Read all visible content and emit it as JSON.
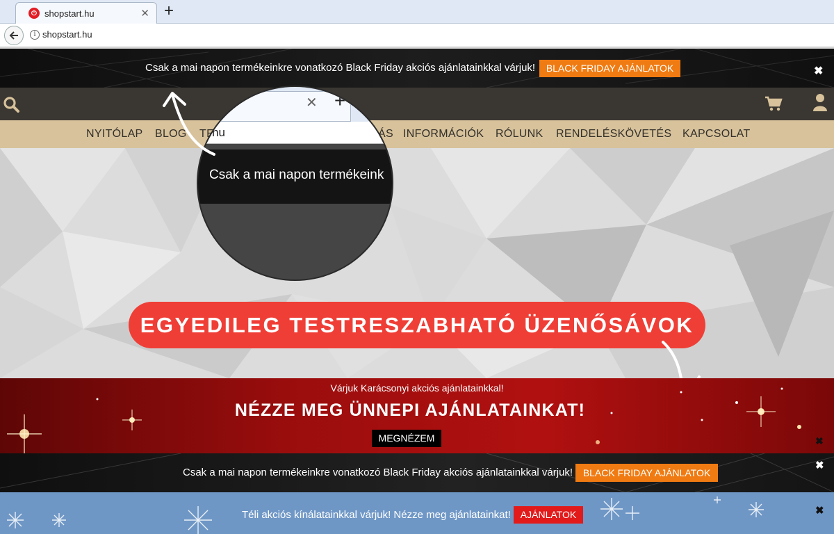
{
  "browser": {
    "tab_title": "shopstart.hu",
    "tab_favicon_color": "#e21c23",
    "url": "shopstart.hu",
    "new_tab_label": "+",
    "close_glyph": "✕"
  },
  "top_bar": {
    "message": "Csak a mai napon termékeinkre vonatkozó Black Friday akciós ajánlatainkkal várjuk!",
    "button_label": "BLACK FRIDAY AJÁNLATOK",
    "button_color": "#f07b12"
  },
  "header": {
    "icons": [
      "search-icon",
      "cart-icon",
      "user-icon"
    ],
    "icon_color": "#d7c29b"
  },
  "menu": {
    "items": [
      "NYITÓLAP",
      "BLOG",
      "TERMÉKEK",
      "AKCIÓS",
      "INFORMÁCIÓK",
      "RÓLUNK",
      "RENDELÉSKÖVETÉS",
      "KAPCSOLAT"
    ],
    "visible": [
      "NYITÓLAP",
      "BLOG",
      "TE",
      "ÁS",
      "INFORMÁCIÓK",
      "RÓLUNK",
      "RENDELÉSKÖVETÉS",
      "KAPCSOLAT"
    ],
    "background": "#d7c29b"
  },
  "magnifier": {
    "url_fragment": "rt.hu",
    "message_fragment": "Csak a mai napon termékeink"
  },
  "hero": {
    "headline": "EGYEDILEG TESTRESZABHATÓ ÜZENŐSÁVOK",
    "headline_color": "#ef3e36"
  },
  "xmas_bar": {
    "subtitle": "Várjuk Karácsonyi akciós ajánlatainkkal!",
    "title": "NÉZZE MEG ÜNNEPI AJÁNLATAINKAT!",
    "button_label": "MEGNÉZEM"
  },
  "bf_bottom": {
    "message": "Csak a mai napon termékeinkre vonatkozó Black Friday akciós ajánlatainkkal várjuk!",
    "button_label": "BLACK FRIDAY AJÁNLATOK"
  },
  "winter_bar": {
    "message": "Téli akciós kínálatainkkal várjuk! Nézze meg ajánlatainkat!",
    "button_label": "AJÁNLATOK",
    "button_color": "#e21a1a"
  }
}
